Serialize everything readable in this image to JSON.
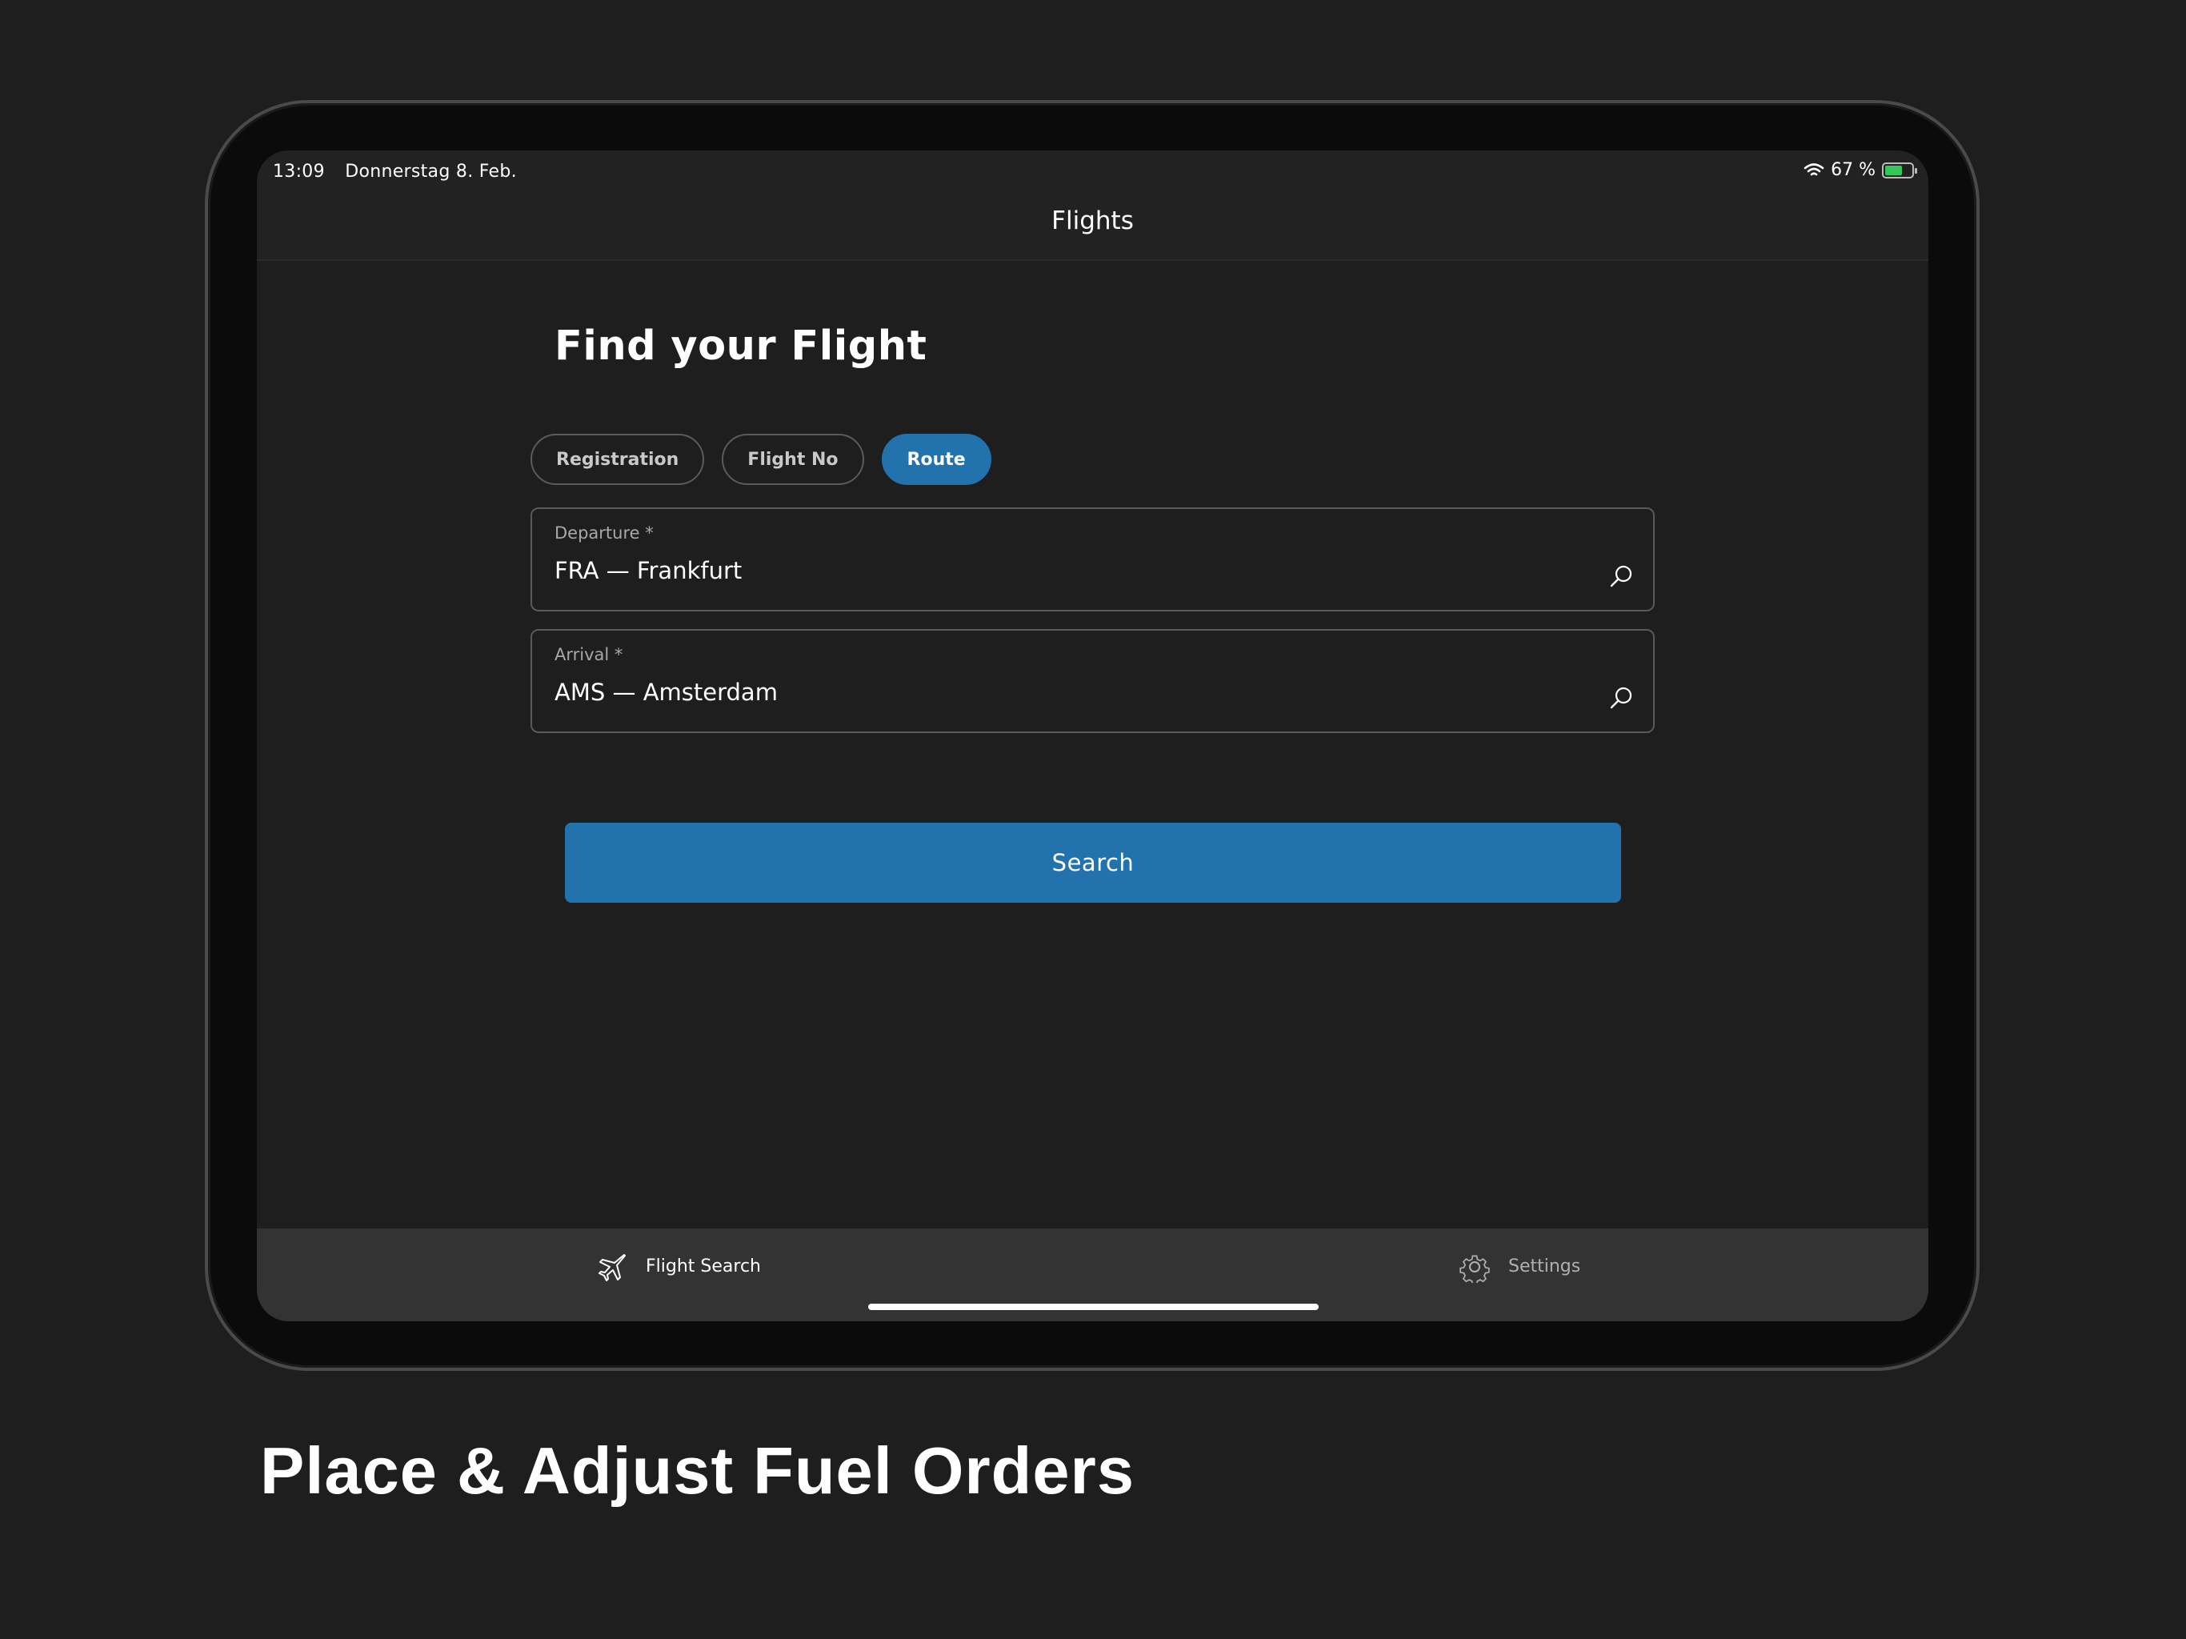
{
  "status_bar": {
    "time": "13:09",
    "date": "Donnerstag 8. Feb.",
    "battery": "67 %",
    "battery_level": 0.67
  },
  "nav": {
    "title": "Flights"
  },
  "main": {
    "heading": "Find your Flight",
    "segments": [
      {
        "label": "Registration",
        "active": false
      },
      {
        "label": "Flight No",
        "active": false
      },
      {
        "label": "Route",
        "active": true
      }
    ],
    "departure": {
      "label": "Departure *",
      "value": "FRA — Frankfurt",
      "icon": "search-icon"
    },
    "arrival": {
      "label": "Arrival *",
      "value": "AMS — Amsterdam",
      "icon": "search-icon"
    },
    "search_label": "Search"
  },
  "tabbar": {
    "tabs": [
      {
        "label": "Flight Search",
        "icon": "airplane-icon",
        "active": true
      },
      {
        "label": "Settings",
        "icon": "gear-icon",
        "active": false
      }
    ]
  },
  "caption": "Place & Adjust Fuel Orders",
  "colors": {
    "accent": "#2172ad",
    "background": "#1e1e1f",
    "battery": "#34c759"
  }
}
